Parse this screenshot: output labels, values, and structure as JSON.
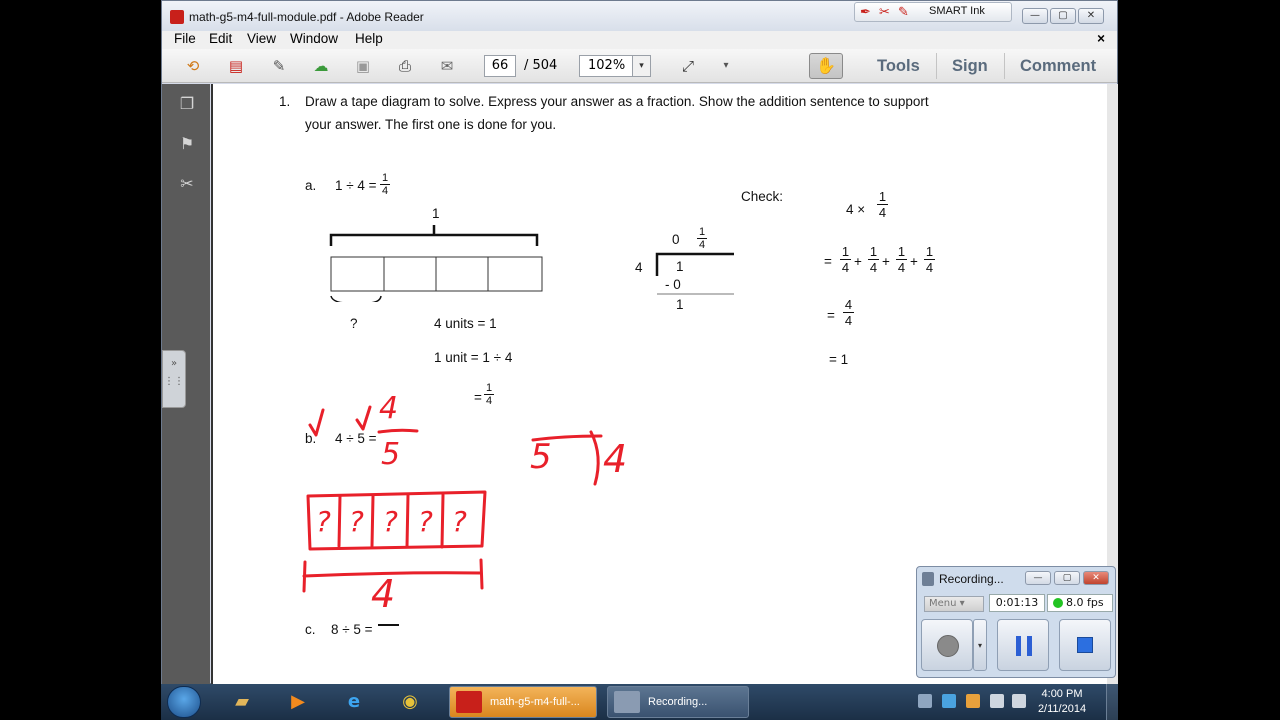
{
  "window": {
    "title": "math-g5-m4-full-module.pdf - Adobe Reader",
    "smart_ink_label": "SMART Ink",
    "minimize": "—",
    "maximize": "▢",
    "close": "✕"
  },
  "menu": {
    "items": [
      "File",
      "Edit",
      "View",
      "Window",
      "Help"
    ],
    "close": "×"
  },
  "toolbar": {
    "current_page": "66",
    "page_total": "/ 504",
    "zoom": "102%",
    "zoom_arrow": "▾",
    "more_arrow": "▾",
    "tools": "Tools",
    "sign": "Sign",
    "comment": "Comment"
  },
  "document": {
    "problem_number": "1.",
    "instruction_line1": "Draw a tape diagram to solve.  Express your answer as a fraction.  Show the addition sentence to support",
    "instruction_line2": "your answer.  The first one is done for you.",
    "part_a_label": "a.",
    "part_a_expr": "1 ÷ 4 =",
    "part_a_frac_num": "1",
    "part_a_frac_den": "4",
    "tape_total_label": "1",
    "unit_question": "?",
    "units_eq": "4 units = 1",
    "unit_eq": "1 unit = 1 ÷ 4",
    "unit_result_prefix": "=",
    "unit_result_num": "1",
    "unit_result_den": "4",
    "check_label": "Check:",
    "division": {
      "divisor": "4",
      "quotient_whole": "0",
      "quotient_num": "1",
      "quotient_den": "4",
      "dividend": "1",
      "subtract": "-  0",
      "remainder": "1"
    },
    "check_expr_prefix": "4 ×",
    "check_frac_num": "1",
    "check_frac_den": "4",
    "sum_prefix": "=",
    "sum_terms_num": [
      "1",
      "1",
      "1",
      "1"
    ],
    "sum_terms_den": [
      "4",
      "4",
      "4",
      "4"
    ],
    "sum_plus": "+",
    "result_prefix": "=",
    "result_num": "4",
    "result_den": "4",
    "final_result": "= 1",
    "part_b_label": "b.",
    "part_b_expr": "4 ÷ 5 =",
    "part_c_label": "c.",
    "part_c_expr": "8 ÷ 5 ="
  },
  "ink": {
    "color": "#e8202a",
    "answer_num": "4",
    "answer_den": "5",
    "divisor": "5",
    "dividend": "4",
    "box_marks": [
      "?",
      "?",
      "?",
      "?",
      "?"
    ],
    "brace_total": "4"
  },
  "recorder": {
    "title": "Recording...",
    "menu_label": "Menu",
    "elapsed": "0:01:13",
    "fps": "8.0 fps"
  },
  "taskbar": {
    "task_pdf": "math-g5-m4-full-...",
    "task_rec": "Recording...",
    "time": "4:00 PM",
    "date": "2/11/2014"
  }
}
